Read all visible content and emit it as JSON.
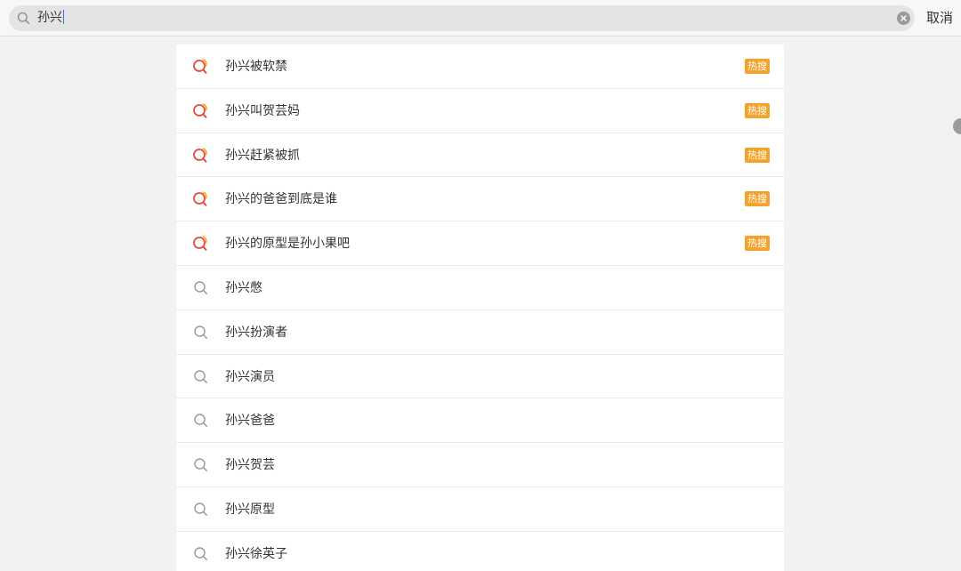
{
  "search": {
    "query": "孙兴",
    "cancel_label": "取消"
  },
  "suggestions": [
    {
      "text": "孙兴被软禁",
      "badge": "热搜",
      "icon": "hot-search-icon"
    },
    {
      "text": "孙兴叫贺芸妈",
      "badge": "热搜",
      "icon": "hot-search-icon"
    },
    {
      "text": "孙兴赶紧被抓",
      "badge": "热搜",
      "icon": "hot-search-icon"
    },
    {
      "text": "孙兴的爸爸到底是谁",
      "badge": "热搜",
      "icon": "hot-search-icon"
    },
    {
      "text": "孙兴的原型是孙小果吧",
      "badge": "热搜",
      "icon": "hot-search-icon"
    },
    {
      "text": "孙兴憋",
      "icon": "search-icon"
    },
    {
      "text": "孙兴扮演者",
      "icon": "search-icon"
    },
    {
      "text": "孙兴演员",
      "icon": "search-icon"
    },
    {
      "text": "孙兴爸爸",
      "icon": "search-icon"
    },
    {
      "text": "孙兴贺芸",
      "icon": "search-icon"
    },
    {
      "text": "孙兴原型",
      "icon": "search-icon"
    },
    {
      "text": "孙兴徐英子",
      "icon": "search-icon"
    }
  ],
  "colors": {
    "hot_icon": "#e84a3a",
    "hot_icon_accent": "#f5a623",
    "badge_bg": "#f5a22b"
  }
}
